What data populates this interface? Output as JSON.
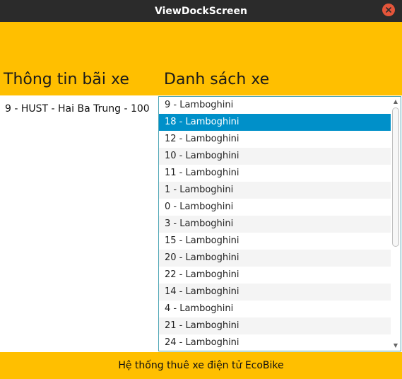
{
  "window": {
    "title": "ViewDockScreen",
    "close_icon": "close-icon"
  },
  "headings": {
    "dock_info": "Thông tin bãi xe",
    "bike_list": "Danh sách xe"
  },
  "dock": {
    "info": "9 - HUST - Hai Ba Trung - 100"
  },
  "bike_list": {
    "items": [
      "9 - Lamboghini",
      "18 - Lamboghini",
      "12 - Lamboghini",
      "10 - Lamboghini",
      "11 - Lamboghini",
      "1 - Lamboghini",
      "0 - Lamboghini",
      "3 - Lamboghini",
      "15 - Lamboghini",
      "20 - Lamboghini",
      "22 - Lamboghini",
      "14 - Lamboghini",
      "4 - Lamboghini",
      "21 - Lamboghini",
      "24 - Lamboghini"
    ],
    "selected_index": 1
  },
  "footer": {
    "text": "Hệ thống thuê xe điện tử EcoBike"
  },
  "colors": {
    "accent": "#ffbf00",
    "selection": "#0090c9",
    "titlebar": "#2b2b2b",
    "close": "#e5553a"
  }
}
